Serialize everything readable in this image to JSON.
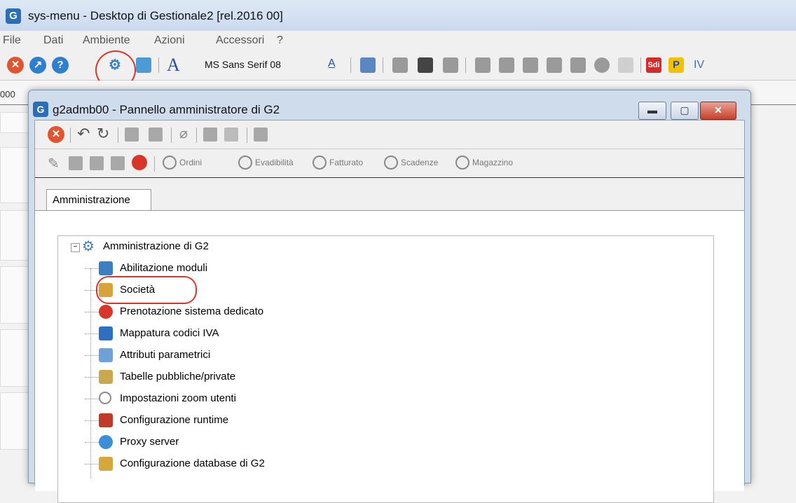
{
  "app": {
    "title": "sys-menu - Desktop di Gestionale2  [rel.2016 00]",
    "logo": "G"
  },
  "menubar": {
    "items": [
      "File",
      "Dati",
      "Ambiente",
      "Azioni",
      "Accessori",
      "?"
    ]
  },
  "toolbar": {
    "font_label": "MS Sans Serif 08",
    "sdi_label": "Sdi",
    "p_label": "P",
    "iv_label": "IV"
  },
  "status": {
    "code": "000"
  },
  "panel": {
    "title": "g2admb00 - Pannello amministratore di G2",
    "logo": "G",
    "window_buttons": {
      "minimize": "▬",
      "maximize": "▢",
      "close": "✕"
    },
    "toolbar2_buttons": [
      "Ordini",
      "Evadibilità",
      "Fatturato",
      "Scadenze",
      "Magazzino"
    ],
    "tab": "Amministrazione",
    "tree": {
      "root": "Amministrazione di G2",
      "expander": "−",
      "items": [
        {
          "label": "Abilitazione moduli",
          "icon": "key-module-icon",
          "color": "#3a7fc1"
        },
        {
          "label": "Società",
          "icon": "people-icon",
          "color": "#d9a23a"
        },
        {
          "label": "Prenotazione sistema dedicato",
          "icon": "forbidden-icon",
          "color": "#d9352a"
        },
        {
          "label": "Mappatura codici IVA",
          "icon": "mapping-icon",
          "color": "#2f6fc2"
        },
        {
          "label": "Attributi parametrici",
          "icon": "table-icon",
          "color": "#6fa0d8"
        },
        {
          "label": "Tabelle pubbliche/private",
          "icon": "lock-table-icon",
          "color": "#c9a84f"
        },
        {
          "label": "Impostazioni zoom utenti",
          "icon": "magnifier-icon",
          "color": "#8a8a8a"
        },
        {
          "label": "Configurazione runtime",
          "icon": "runtime-icon",
          "color": "#c0392b"
        },
        {
          "label": "Proxy server",
          "icon": "network-icon",
          "color": "#3b8fd9"
        },
        {
          "label": "Configurazione database di G2",
          "icon": "database-config-icon",
          "color": "#d6a73a"
        }
      ]
    }
  },
  "colors": {
    "highlight_ring": "#d9352a",
    "title_bar": "#c9d9ee"
  }
}
